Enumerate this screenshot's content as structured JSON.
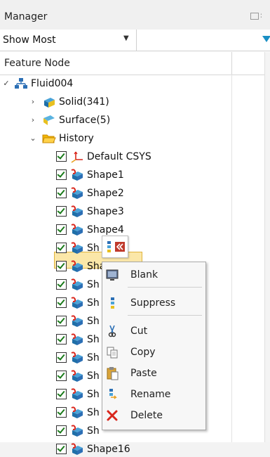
{
  "header": {
    "title": "Manager"
  },
  "filter": {
    "selected": "Show Most",
    "filter_value": ""
  },
  "columns": {
    "feature_node": "Feature Node"
  },
  "tree": {
    "root": "Fluid004",
    "solid": "Solid(341)",
    "surface": "Surface(5)",
    "history": "History",
    "default_csys": "Default CSYS",
    "shapes": [
      "Shape1",
      "Shape2",
      "Shape3",
      "Shape4",
      "Sh",
      "Shape",
      "Sh",
      "Sh",
      "Sh",
      "Sh",
      "Sh",
      "Sh",
      "Sh",
      "Sh",
      "Sh",
      "Shape16"
    ]
  },
  "context_menu": {
    "blank": "Blank",
    "suppress": "Suppress",
    "cut": "Cut",
    "copy": "Copy",
    "paste": "Paste",
    "rename": "Rename",
    "delete": "Delete"
  },
  "colors": {
    "selection_bg": "#fbe7a8",
    "selection_border": "#e0b43c",
    "check_green": "#1a7a1a",
    "accent_blue": "#1a8fc4",
    "delete_red": "#d9261c"
  },
  "icons": {
    "expand": "chevron-right-icon",
    "collapse": "chevron-down-icon",
    "root": "assembly-icon",
    "solid": "solid-body-icon",
    "surface": "surface-body-icon",
    "history": "folder-open-icon",
    "csys": "coordinate-system-icon",
    "shape": "shape-feature-icon"
  }
}
